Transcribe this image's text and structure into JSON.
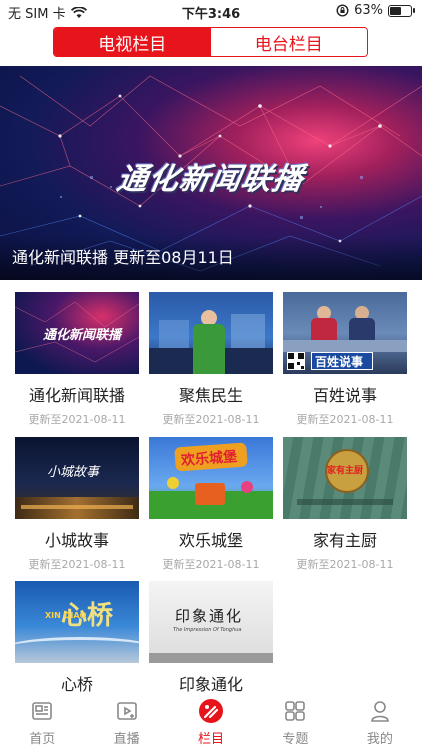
{
  "status_bar": {
    "carrier": "无 SIM 卡",
    "time": "下午3:46",
    "battery": "63%",
    "battery_level": 0.63
  },
  "segments": [
    {
      "label": "电视栏目",
      "active": true
    },
    {
      "label": "电台栏目",
      "active": false
    }
  ],
  "banner": {
    "title_art": "通化新闻联播",
    "caption": "通化新闻联播 更新至08月11日"
  },
  "programs": [
    {
      "title": "通化新闻联播",
      "updated": "更新至2021-08-11",
      "thumb_text": "通化新闻联播"
    },
    {
      "title": "聚焦民生",
      "updated": "更新至2021-08-11"
    },
    {
      "title": "百姓说事",
      "updated": "更新至2021-08-11",
      "thumb_text": "百姓说事"
    },
    {
      "title": "小城故事",
      "updated": "更新至2021-08-11",
      "thumb_text": "小城故事"
    },
    {
      "title": "欢乐城堡",
      "updated": "更新至2021-08-11",
      "thumb_text": "欢乐城堡"
    },
    {
      "title": "家有主厨",
      "updated": "更新至2021-08-11",
      "thumb_text": "家有主厨"
    },
    {
      "title": "心桥",
      "updated": "",
      "thumb_text": "心桥",
      "thumb_sub": "XIN QIAO"
    },
    {
      "title": "印象通化",
      "updated": "",
      "thumb_text": "印象通化",
      "thumb_sub": "The Impression Of Tonghua"
    }
  ],
  "tabs": [
    {
      "label": "首页",
      "icon": "news-icon",
      "active": false
    },
    {
      "label": "直播",
      "icon": "live-tv-icon",
      "active": false
    },
    {
      "label": "栏目",
      "icon": "column-icon",
      "active": true
    },
    {
      "label": "专题",
      "icon": "topics-icon",
      "active": false
    },
    {
      "label": "我的",
      "icon": "profile-icon",
      "active": false
    }
  ],
  "colors": {
    "accent": "#e8141c",
    "inactive": "#888888",
    "subtext": "#a8a8a8"
  }
}
